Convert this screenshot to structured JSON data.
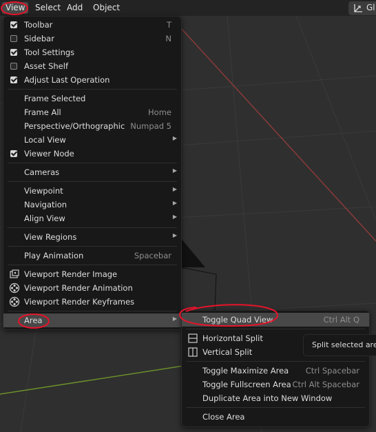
{
  "header": {
    "menus": [
      "View",
      "Select",
      "Add",
      "Object"
    ],
    "gizmo_label": "Gl"
  },
  "view_menu": {
    "items": [
      {
        "label": "Toolbar",
        "checked": true,
        "shortcut": "T"
      },
      {
        "label": "Sidebar",
        "checked": false,
        "shortcut": "N"
      },
      {
        "label": "Tool Settings",
        "checked": true,
        "shortcut": ""
      },
      {
        "label": "Asset Shelf",
        "checked": false,
        "shortcut": ""
      },
      {
        "label": "Adjust Last Operation",
        "checked": true,
        "shortcut": ""
      },
      {
        "label": "Frame Selected",
        "shortcut": ""
      },
      {
        "label": "Frame All",
        "shortcut": "Home"
      },
      {
        "label": "Perspective/Orthographic",
        "shortcut": "Numpad 5"
      },
      {
        "label": "Local View",
        "submenu": true
      },
      {
        "label": "Viewer Node",
        "checked": true
      },
      {
        "label": "Cameras",
        "submenu": true
      },
      {
        "label": "Viewpoint",
        "submenu": true
      },
      {
        "label": "Navigation",
        "submenu": true
      },
      {
        "label": "Align View",
        "submenu": true
      },
      {
        "label": "View Regions",
        "submenu": true
      },
      {
        "label": "Play Animation",
        "shortcut": "Spacebar"
      },
      {
        "label": "Viewport Render Image",
        "icon": "render-image-icon"
      },
      {
        "label": "Viewport Render Animation",
        "icon": "render-animation-icon"
      },
      {
        "label": "Viewport Render Keyframes",
        "icon": "render-keyframes-icon"
      },
      {
        "label": "Area",
        "submenu": true,
        "highlighted": true
      }
    ]
  },
  "area_submenu": {
    "items": [
      {
        "label": "Toggle Quad View",
        "shortcut": "Ctrl Alt Q",
        "highlighted": true
      },
      {
        "label": "Horizontal Split",
        "icon": "horizontal-split-icon"
      },
      {
        "label": "Vertical Split",
        "icon": "vertical-split-icon"
      },
      {
        "label": "Toggle Maximize Area",
        "shortcut": "Ctrl Spacebar"
      },
      {
        "label": "Toggle Fullscreen Area",
        "shortcut": "Ctrl Alt Spacebar"
      },
      {
        "label": "Duplicate Area into New Window",
        "shortcut": ""
      },
      {
        "label": "Close Area",
        "shortcut": ""
      }
    ]
  },
  "tooltip": {
    "text": "Split selected area"
  },
  "colors": {
    "menu_bg": "#181818",
    "highlight": "#484848",
    "annotation_red": "#e8132a",
    "axis_green": "#6b8f2a"
  }
}
